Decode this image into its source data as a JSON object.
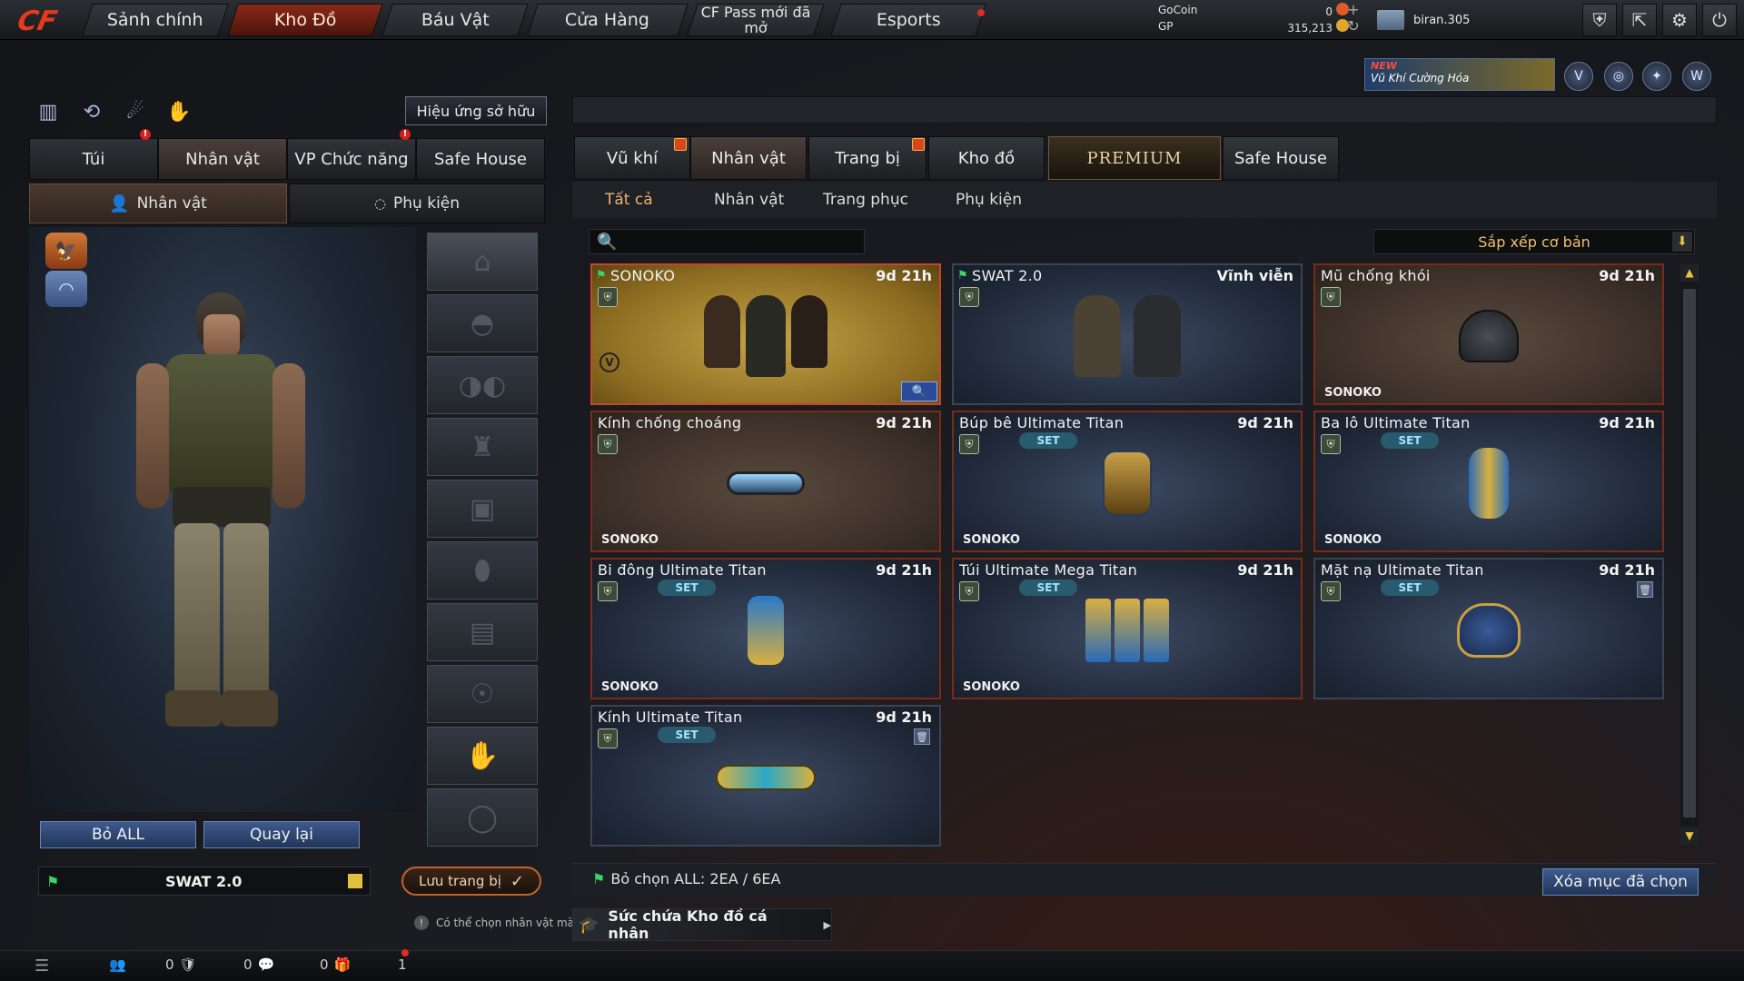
{
  "logo": "CF",
  "nav": {
    "tabs": [
      "Sảnh chính",
      "Kho Đồ",
      "Báu Vật",
      "Cửa Hàng",
      "CF Pass mới đã mở",
      "Esports"
    ],
    "active_index": 1
  },
  "currency": {
    "gocoin_label": "GoCoin",
    "gocoin_value": "0",
    "gp_label": "GP",
    "gp_value": "315,213"
  },
  "user": {
    "name": "biran.305"
  },
  "promo": {
    "badge": "NEW",
    "text": "Vũ Khí Cường Hóa"
  },
  "left": {
    "effect_button": "Hiệu ứng sở hữu",
    "tabs": [
      "Túi",
      "Nhân vật",
      "VP Chức năng",
      "Safe House"
    ],
    "active_tab": 1,
    "subtabs": [
      "Nhân vật",
      "Phụ kiện"
    ],
    "active_subtab": 0,
    "reset_all": "Bỏ ALL",
    "back": "Quay lại",
    "preset_name": "SWAT 2.0",
    "save_button": "Lưu trang bị",
    "hint": "Có thể chọn nhân vật mà"
  },
  "right": {
    "tabs": [
      "Vũ khí",
      "Nhân vật",
      "Trang bị",
      "Kho đồ",
      "PREMIUM",
      "Safe House"
    ],
    "active_tab": 1,
    "filters": [
      "Tất cả",
      "Nhân vật",
      "Trang phục",
      "Phụ kiện"
    ],
    "active_filter": 0,
    "search_placeholder": "",
    "sort_label": "Sắp xếp cơ bản",
    "items": [
      {
        "name": "SONOKO",
        "time": "9d 21h",
        "owner": "",
        "set": false,
        "style": "gold",
        "art": "squad3"
      },
      {
        "name": "SWAT 2.0",
        "time": "Vĩnh viễn",
        "owner": "",
        "set": false,
        "style": "nosel",
        "art": "squad2"
      },
      {
        "name": "Mũ chống khói",
        "time": "9d 21h",
        "owner": "SONOKO",
        "set": false,
        "style": "brown",
        "art": "helmet"
      },
      {
        "name": "Kính chống choáng",
        "time": "9d 21h",
        "owner": "SONOKO",
        "set": false,
        "style": "brown",
        "art": "goggles"
      },
      {
        "name": "Búp bê Ultimate Titan",
        "time": "9d 21h",
        "owner": "SONOKO",
        "set": true,
        "style": "blue",
        "art": "doll"
      },
      {
        "name": "Ba lô Ultimate Titan",
        "time": "9d 21h",
        "owner": "SONOKO",
        "set": true,
        "style": "blue",
        "art": "backpack"
      },
      {
        "name": "Bi đông Ultimate Titan",
        "time": "9d 21h",
        "owner": "SONOKO",
        "set": true,
        "style": "blue",
        "art": "canteen"
      },
      {
        "name": "Túi Ultimate Mega Titan",
        "time": "9d 21h",
        "owner": "SONOKO",
        "set": true,
        "style": "blue",
        "art": "pouch"
      },
      {
        "name": "Mặt nạ Ultimate Titan",
        "time": "9d 21h",
        "owner": "",
        "set": true,
        "style": "nosel",
        "art": "mask"
      },
      {
        "name": "Kính Ultimate Titan",
        "time": "9d 21h",
        "owner": "",
        "set": true,
        "style": "nosel",
        "art": "glasses"
      }
    ],
    "set_label": "SET",
    "selection_info": "Bỏ chọn ALL: 2EA / 6EA",
    "delete_button": "Xóa mục đã chọn",
    "capacity": "Sức chứa Kho đồ cá nhân"
  },
  "bottom": {
    "counts": [
      "0",
      "0",
      "0",
      "1"
    ]
  },
  "colors": {
    "accent_orange": "#c0652a",
    "active_red": "#8a2a18",
    "button_blue": "#3e5a8e",
    "gold_text": "#f0c06a"
  }
}
